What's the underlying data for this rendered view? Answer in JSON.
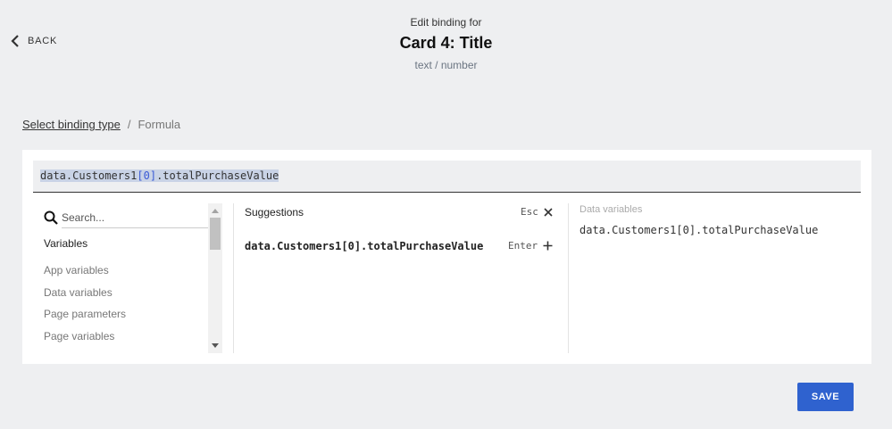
{
  "nav": {
    "back_label": "BACK"
  },
  "header": {
    "subtitle": "Edit binding for",
    "title": "Card 4: Title",
    "type": "text / number"
  },
  "breadcrumb": {
    "link": "Select binding type",
    "separator": "/",
    "current": "Formula"
  },
  "formula": {
    "part1": "data.Customers1",
    "bracket_open": "[",
    "index": "0",
    "bracket_close": "]",
    "part2": ".totalPurchaseValue"
  },
  "search": {
    "placeholder": "Search..."
  },
  "variables": {
    "heading": "Variables",
    "items": [
      "App variables",
      "Data variables",
      "Page parameters",
      "Page variables"
    ]
  },
  "suggestions": {
    "title": "Suggestions",
    "esc_label": "Esc",
    "item": "data.Customers1[0].totalPurchaseValue",
    "enter_label": "Enter"
  },
  "data_variables": {
    "title": "Data variables",
    "value": "data.Customers1[0].totalPurchaseValue"
  },
  "actions": {
    "save_label": "SAVE"
  },
  "colors": {
    "accent": "#2f62cf",
    "background": "#eeeff1",
    "highlight": "#c9d3e6"
  }
}
